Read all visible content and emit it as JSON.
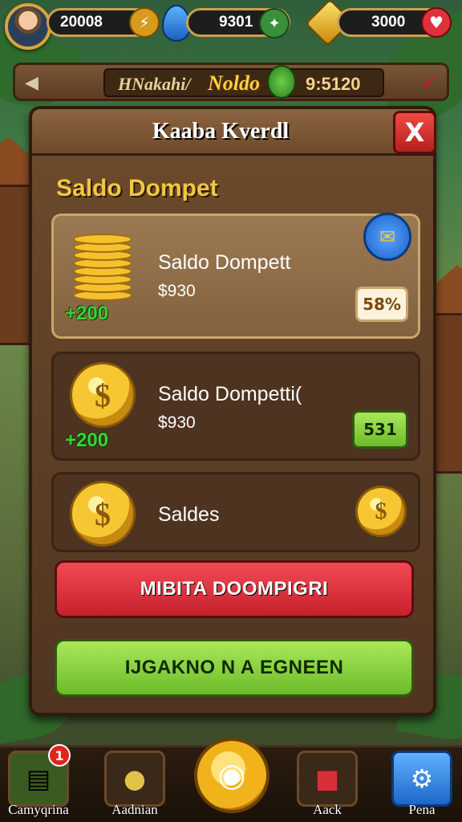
{
  "topbar": {
    "currency1": {
      "value": "20008",
      "icon": "bolt-icon"
    },
    "currency2": {
      "value": "9301",
      "icon": "leaf-gem-icon"
    },
    "currency3": {
      "value": "3000",
      "icon": "gold-gem-icon"
    }
  },
  "statusbar": {
    "name": "HNakahi/",
    "title": "Noldo",
    "value": "9:5120"
  },
  "panel": {
    "title": "Kaaba Kverdl",
    "close_label": "X",
    "section_title": "Saldo Dompet"
  },
  "cards": [
    {
      "title": "Saldo Dompett",
      "subtitle": "$930",
      "bonus": "+200",
      "tag": "58%",
      "highlight": true
    },
    {
      "title": "Saldo Dompetti(",
      "subtitle": "$930",
      "bonus": "+200",
      "tag": "531",
      "highlight": false
    },
    {
      "title": "Saldes",
      "subtitle": "",
      "bonus": "",
      "tag": "",
      "highlight": false
    }
  ],
  "buttons": {
    "primary": "MIBITA DOOMPIGRI",
    "secondary": "IJGAKNO N A EGNEEN"
  },
  "bottom_nav": [
    {
      "label": "Camyqrina",
      "icon": "cash-stack-icon",
      "badge": "1"
    },
    {
      "label": "Aadnian",
      "icon": "sack-icon",
      "badge": ""
    },
    {
      "label": "",
      "icon": "coin-center-icon",
      "badge": ""
    },
    {
      "label": "Aack",
      "icon": "gift-box-icon",
      "badge": ""
    },
    {
      "label": "Pena",
      "icon": "settings-icon",
      "badge": ""
    }
  ],
  "colors": {
    "accent_gold": "#f2c640",
    "red_button": "#e0323b",
    "green_button": "#8fd345",
    "wood": "#6e4b2c"
  }
}
